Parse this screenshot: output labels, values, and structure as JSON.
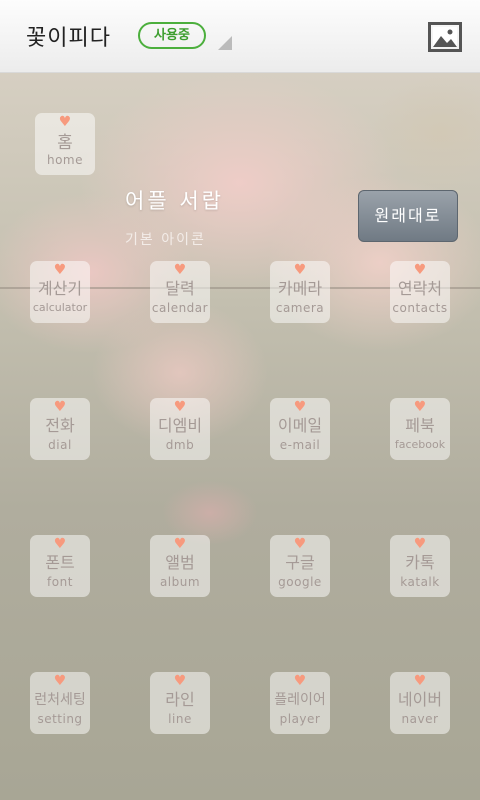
{
  "topbar": {
    "title": "꽃이피다",
    "badge": "사용중",
    "image_icon": "image-icon"
  },
  "header": {
    "home_icon": {
      "kr": "홈",
      "en": "home"
    },
    "app_title": "어플 서랍",
    "subtitle": "기본 아이콘",
    "restore_button": "원래대로"
  },
  "icons": [
    {
      "kr": "계산기",
      "en": "calculator"
    },
    {
      "kr": "달력",
      "en": "calendar"
    },
    {
      "kr": "카메라",
      "en": "camera"
    },
    {
      "kr": "연락처",
      "en": "contacts"
    },
    {
      "kr": "전화",
      "en": "dial"
    },
    {
      "kr": "디엠비",
      "en": "dmb"
    },
    {
      "kr": "이메일",
      "en": "e-mail"
    },
    {
      "kr": "페북",
      "en": "facebook"
    },
    {
      "kr": "폰트",
      "en": "font"
    },
    {
      "kr": "앨범",
      "en": "album"
    },
    {
      "kr": "구글",
      "en": "google"
    },
    {
      "kr": "카톡",
      "en": "katalk"
    },
    {
      "kr": "런처세팅",
      "en": "setting"
    },
    {
      "kr": "라인",
      "en": "line"
    },
    {
      "kr": "플레이어",
      "en": "player"
    },
    {
      "kr": "네이버",
      "en": "naver"
    }
  ],
  "colors": {
    "badge_green": "#4caf3d",
    "heart": "#f79a7e",
    "icon_text": "#a59a96",
    "restore_button": "#7f8891"
  }
}
